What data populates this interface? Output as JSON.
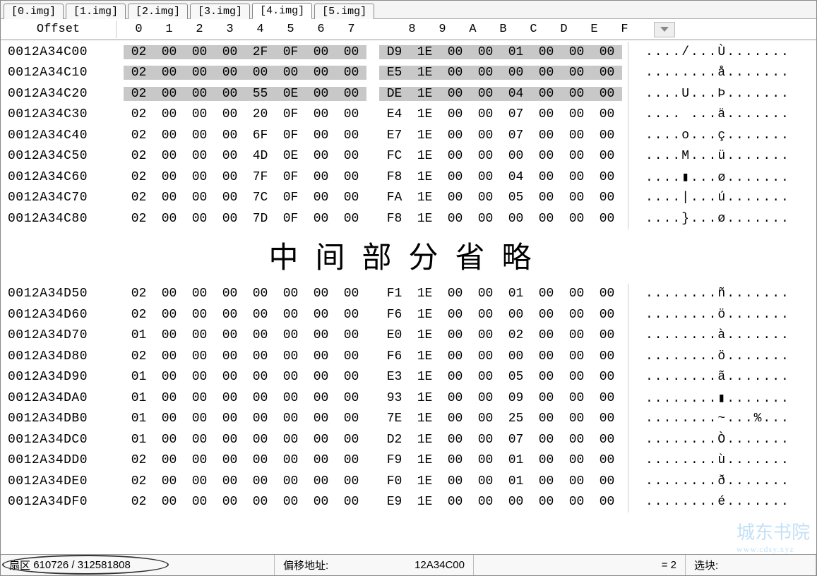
{
  "tabs": [
    {
      "label": "[0.img]",
      "active": false
    },
    {
      "label": "[1.img]",
      "active": false
    },
    {
      "label": "[2.img]",
      "active": false
    },
    {
      "label": "[3.img]",
      "active": false
    },
    {
      "label": "[4.img]",
      "active": true
    },
    {
      "label": "[5.img]",
      "active": false
    }
  ],
  "header": {
    "offset_label": "Offset",
    "columns": [
      "0",
      "1",
      "2",
      "3",
      "4",
      "5",
      "6",
      "7",
      "8",
      "9",
      "A",
      "B",
      "C",
      "D",
      "E",
      "F"
    ]
  },
  "rows_top": [
    {
      "offset": "0012A34C00",
      "hex": [
        "02",
        "00",
        "00",
        "00",
        "2F",
        "0F",
        "00",
        "00",
        "D9",
        "1E",
        "00",
        "00",
        "01",
        "00",
        "00",
        "00"
      ],
      "ascii": "..../...Ù.......",
      "hi": true
    },
    {
      "offset": "0012A34C10",
      "hex": [
        "02",
        "00",
        "00",
        "00",
        "00",
        "00",
        "00",
        "00",
        "E5",
        "1E",
        "00",
        "00",
        "00",
        "00",
        "00",
        "00"
      ],
      "ascii": "........å.......",
      "hi": true
    },
    {
      "offset": "0012A34C20",
      "hex": [
        "02",
        "00",
        "00",
        "00",
        "55",
        "0E",
        "00",
        "00",
        "DE",
        "1E",
        "00",
        "00",
        "04",
        "00",
        "00",
        "00"
      ],
      "ascii": "....U...Þ.......",
      "hi": true
    },
    {
      "offset": "0012A34C30",
      "hex": [
        "02",
        "00",
        "00",
        "00",
        "20",
        "0F",
        "00",
        "00",
        "E4",
        "1E",
        "00",
        "00",
        "07",
        "00",
        "00",
        "00"
      ],
      "ascii": ".... ...ä.......",
      "hi": false
    },
    {
      "offset": "0012A34C40",
      "hex": [
        "02",
        "00",
        "00",
        "00",
        "6F",
        "0F",
        "00",
        "00",
        "E7",
        "1E",
        "00",
        "00",
        "07",
        "00",
        "00",
        "00"
      ],
      "ascii": "....o...ç.......",
      "hi": false
    },
    {
      "offset": "0012A34C50",
      "hex": [
        "02",
        "00",
        "00",
        "00",
        "4D",
        "0E",
        "00",
        "00",
        "FC",
        "1E",
        "00",
        "00",
        "00",
        "00",
        "00",
        "00"
      ],
      "ascii": "....M...ü.......",
      "hi": false
    },
    {
      "offset": "0012A34C60",
      "hex": [
        "02",
        "00",
        "00",
        "00",
        "7F",
        "0F",
        "00",
        "00",
        "F8",
        "1E",
        "00",
        "00",
        "04",
        "00",
        "00",
        "00"
      ],
      "ascii": "....▮...ø.......",
      "hi": false
    },
    {
      "offset": "0012A34C70",
      "hex": [
        "02",
        "00",
        "00",
        "00",
        "7C",
        "0F",
        "00",
        "00",
        "FA",
        "1E",
        "00",
        "00",
        "05",
        "00",
        "00",
        "00"
      ],
      "ascii": "....|...ú.......",
      "hi": false
    },
    {
      "offset": "0012A34C80",
      "hex": [
        "02",
        "00",
        "00",
        "00",
        "7D",
        "0F",
        "00",
        "00",
        "F8",
        "1E",
        "00",
        "00",
        "00",
        "00",
        "00",
        "00"
      ],
      "ascii": "....}...ø.......",
      "hi": false
    }
  ],
  "omit_label": "中间部分省略",
  "rows_bottom": [
    {
      "offset": "0012A34D50",
      "hex": [
        "02",
        "00",
        "00",
        "00",
        "00",
        "00",
        "00",
        "00",
        "F1",
        "1E",
        "00",
        "00",
        "01",
        "00",
        "00",
        "00"
      ],
      "ascii": "........ñ.......",
      "hi": false
    },
    {
      "offset": "0012A34D60",
      "hex": [
        "02",
        "00",
        "00",
        "00",
        "00",
        "00",
        "00",
        "00",
        "F6",
        "1E",
        "00",
        "00",
        "00",
        "00",
        "00",
        "00"
      ],
      "ascii": "........ö.......",
      "hi": false
    },
    {
      "offset": "0012A34D70",
      "hex": [
        "01",
        "00",
        "00",
        "00",
        "00",
        "00",
        "00",
        "00",
        "E0",
        "1E",
        "00",
        "00",
        "02",
        "00",
        "00",
        "00"
      ],
      "ascii": "........à.......",
      "hi": false
    },
    {
      "offset": "0012A34D80",
      "hex": [
        "02",
        "00",
        "00",
        "00",
        "00",
        "00",
        "00",
        "00",
        "F6",
        "1E",
        "00",
        "00",
        "00",
        "00",
        "00",
        "00"
      ],
      "ascii": "........ö.......",
      "hi": false
    },
    {
      "offset": "0012A34D90",
      "hex": [
        "01",
        "00",
        "00",
        "00",
        "00",
        "00",
        "00",
        "00",
        "E3",
        "1E",
        "00",
        "00",
        "05",
        "00",
        "00",
        "00"
      ],
      "ascii": "........ã.......",
      "hi": false
    },
    {
      "offset": "0012A34DA0",
      "hex": [
        "01",
        "00",
        "00",
        "00",
        "00",
        "00",
        "00",
        "00",
        "93",
        "1E",
        "00",
        "00",
        "09",
        "00",
        "00",
        "00"
      ],
      "ascii": "........▮.......",
      "hi": false
    },
    {
      "offset": "0012A34DB0",
      "hex": [
        "01",
        "00",
        "00",
        "00",
        "00",
        "00",
        "00",
        "00",
        "7E",
        "1E",
        "00",
        "00",
        "25",
        "00",
        "00",
        "00"
      ],
      "ascii": "........~...%...",
      "hi": false
    },
    {
      "offset": "0012A34DC0",
      "hex": [
        "01",
        "00",
        "00",
        "00",
        "00",
        "00",
        "00",
        "00",
        "D2",
        "1E",
        "00",
        "00",
        "07",
        "00",
        "00",
        "00"
      ],
      "ascii": "........Ò.......",
      "hi": false
    },
    {
      "offset": "0012A34DD0",
      "hex": [
        "02",
        "00",
        "00",
        "00",
        "00",
        "00",
        "00",
        "00",
        "F9",
        "1E",
        "00",
        "00",
        "01",
        "00",
        "00",
        "00"
      ],
      "ascii": "........ù.......",
      "hi": false
    },
    {
      "offset": "0012A34DE0",
      "hex": [
        "02",
        "00",
        "00",
        "00",
        "00",
        "00",
        "00",
        "00",
        "F0",
        "1E",
        "00",
        "00",
        "01",
        "00",
        "00",
        "00"
      ],
      "ascii": "........ð.......",
      "hi": false
    },
    {
      "offset": "0012A34DF0",
      "hex": [
        "02",
        "00",
        "00",
        "00",
        "00",
        "00",
        "00",
        "00",
        "E9",
        "1E",
        "00",
        "00",
        "00",
        "00",
        "00",
        "00"
      ],
      "ascii": "........é.......",
      "hi": false
    }
  ],
  "status": {
    "sector_label": "扇区",
    "sector_value": "610726 / 312581808",
    "offset_label": "偏移地址:",
    "offset_value": "12A34C00",
    "eq_value": "= 2",
    "select_label": "选块:"
  },
  "watermark": {
    "main": "城东书院",
    "sub": "www.cdsy.xyz"
  }
}
